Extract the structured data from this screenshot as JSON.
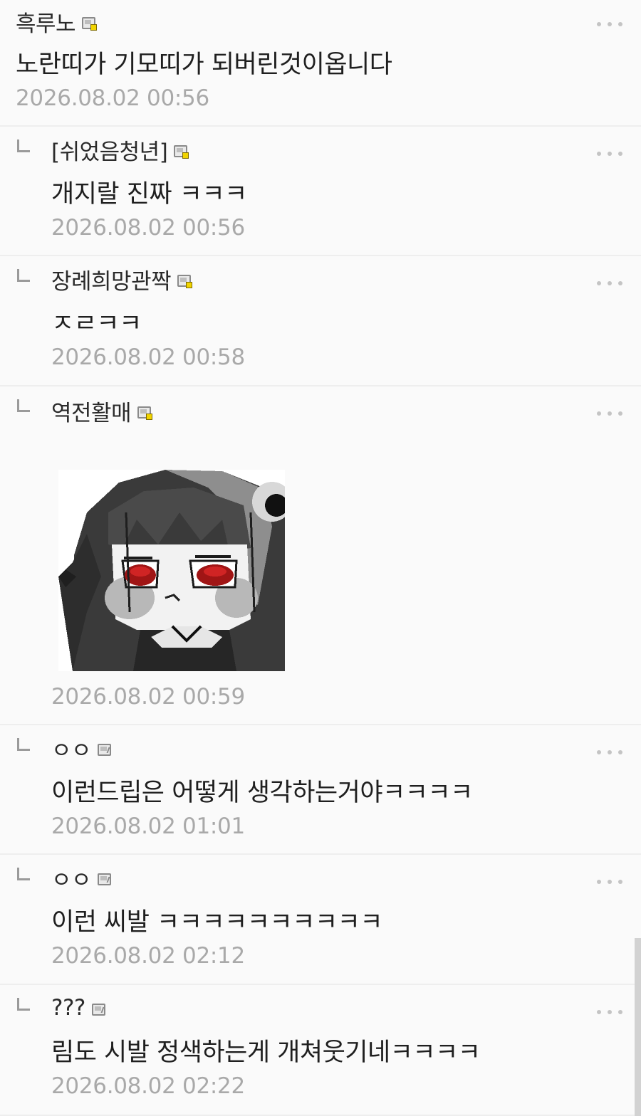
{
  "comments": [
    {
      "nick": "흑루노",
      "text": "노란띠가 기모띠가 되버린것이옵니다",
      "time": "2026.08.02 00:56",
      "member_icon": "fixed-nick-icon",
      "is_reply": false
    },
    {
      "nick": "[쉬었음청년]",
      "text": "개지랄 진짜 ㅋㅋㅋ",
      "time": "2026.08.02 00:56",
      "member_icon": "fixed-nick-icon",
      "is_reply": true
    },
    {
      "nick": "장례희망관짝",
      "text": "ㅈㄹㅋㅋ",
      "time": "2026.08.02 00:58",
      "member_icon": "fixed-nick-icon",
      "is_reply": true
    },
    {
      "nick": "역전활매",
      "text": "",
      "time": "2026.08.02 00:59",
      "member_icon": "fixed-nick-icon",
      "is_reply": true,
      "attachment": "pixel-art-dark-haired-girl-sticker"
    },
    {
      "nick": "ㅇㅇ",
      "text": "이런드립은 어떻게 생각하는거야ㅋㅋㅋㅋ",
      "time": "2026.08.02 01:01",
      "member_icon": "flow-nick-icon",
      "is_reply": true
    },
    {
      "nick": "ㅇㅇ",
      "text": "이런 씨발 ㅋㅋㅋㅋㅋㅋㅋㅋㅋㅋ",
      "time": "2026.08.02 02:12",
      "member_icon": "flow-nick-icon",
      "is_reply": true
    },
    {
      "nick": "???",
      "text": "림도 시발 정색하는게 개쳐웃기네ㅋㅋㅋㅋ",
      "time": "2026.08.02 02:22",
      "member_icon": "flow-nick-icon",
      "is_reply": true
    }
  ],
  "colors": {
    "background": "#fafafa",
    "divider": "#eeeeee",
    "timestamp": "#a9a9a9",
    "fixed_badge": "#f1d400"
  }
}
